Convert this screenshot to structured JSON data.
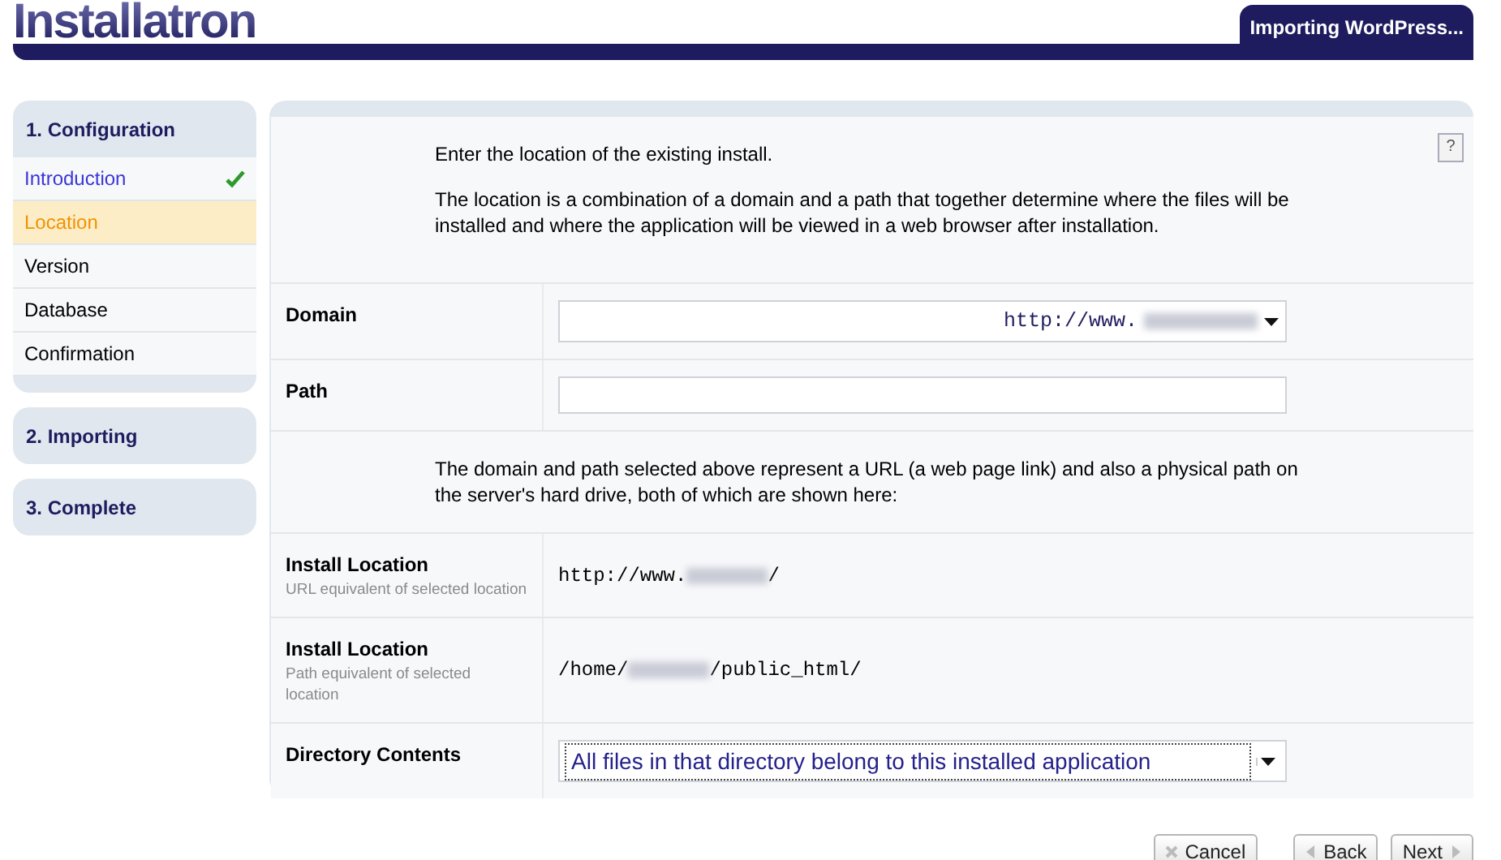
{
  "header": {
    "logo": "Installatron",
    "tab": "Importing WordPress..."
  },
  "steps": [
    {
      "title": "1. Configuration",
      "items": [
        {
          "label": "Introduction",
          "done": true,
          "selected": false
        },
        {
          "label": "Location",
          "done": false,
          "selected": true
        },
        {
          "label": "Version",
          "done": false,
          "selected": false
        },
        {
          "label": "Database",
          "done": false,
          "selected": false
        },
        {
          "label": "Confirmation",
          "done": false,
          "selected": false
        }
      ]
    },
    {
      "title": "2. Importing"
    },
    {
      "title": "3. Complete"
    }
  ],
  "help": "?",
  "rows": [
    {
      "kind": "text",
      "paragraphs": [
        "Enter the location of the existing install.",
        "The location is a combination of a domain and a path that together determine where the files will be installed and where the application will be viewed in a web browser after installation."
      ]
    },
    {
      "kind": "select",
      "label": "Domain",
      "value": "http://www.",
      "blurred": true,
      "mono": true,
      "focused": false
    },
    {
      "kind": "input",
      "label": "Path"
    },
    {
      "kind": "text",
      "paragraphs": [
        "The domain and path selected above represent a URL (a web page link) and also a physical path on the server's hard drive, both of which are shown here:"
      ]
    },
    {
      "kind": "info",
      "label": "Install Location",
      "hint": "URL equivalent of selected location",
      "prefix": "http://www.",
      "suffix": "/"
    },
    {
      "kind": "info",
      "label": "Install Location",
      "hint": "Path equivalent of selected location",
      "prefix": "/home/",
      "suffix": "/public_html/"
    },
    {
      "kind": "select",
      "label": "Directory Contents",
      "value": "All files in that directory belong to this installed application",
      "blurred": false,
      "mono": false,
      "focused": true
    }
  ],
  "buttons": [
    {
      "label": "Cancel",
      "kind": "cancel"
    },
    {
      "label": "Back",
      "kind": "back"
    },
    {
      "label": "Next",
      "kind": "next"
    }
  ]
}
